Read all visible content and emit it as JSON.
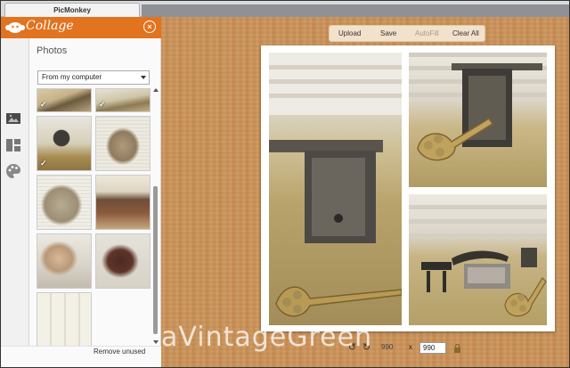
{
  "browser": {
    "tab_title": "PicMonkey"
  },
  "app": {
    "title": "Collage",
    "brand_color": "#e2731f"
  },
  "rail": {
    "items": [
      {
        "icon": "image-icon",
        "active": true
      },
      {
        "icon": "layouts-icon",
        "active": false
      },
      {
        "icon": "palette-icon",
        "active": false
      }
    ]
  },
  "panel": {
    "title": "Photos",
    "source": {
      "selected": "From my computer"
    },
    "thumbnails": [
      {
        "subject": "key",
        "checked": true
      },
      {
        "subject": "key",
        "checked": true
      },
      {
        "subject": "lock",
        "checked": true
      },
      {
        "subject": "jar",
        "checked": false
      },
      {
        "subject": "jar",
        "checked": false
      },
      {
        "subject": "box",
        "checked": false
      },
      {
        "subject": "doll",
        "checked": false
      },
      {
        "subject": "tin",
        "checked": false
      },
      {
        "subject": "screen",
        "checked": false
      }
    ],
    "remove_unused": "Remove unused"
  },
  "toolbar": {
    "upload": "Upload",
    "save": "Save",
    "autofill": "AutoFill",
    "clear_all": "Clear All"
  },
  "canvas": {
    "width": "990",
    "height": "990",
    "times": "x"
  },
  "watermark": "aVintageGreen"
}
